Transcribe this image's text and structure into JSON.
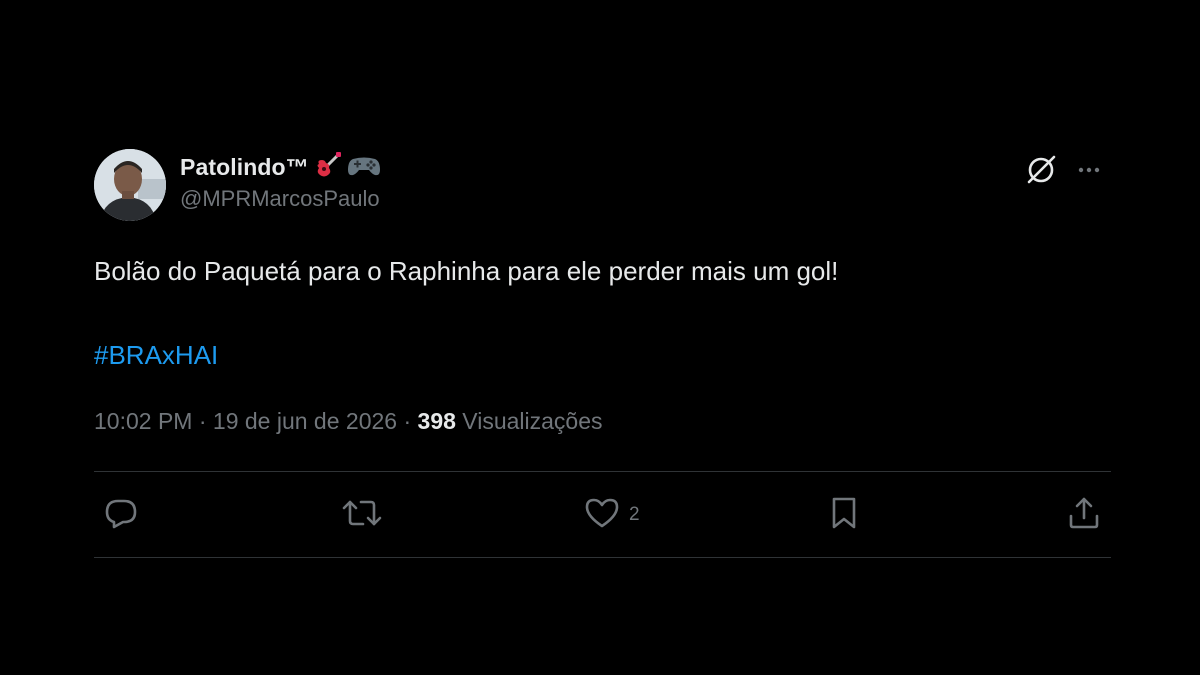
{
  "tweet": {
    "display_name": "Patolindo™",
    "name_emojis": [
      "guitar-emoji",
      "gamepad-emoji"
    ],
    "handle": "@MPRMarcosPaulo",
    "text": "Bolão do Paquetá para o Raphinha para ele perder mais um gol!",
    "hashtag": "#BRAxHAI",
    "time": "10:02 PM",
    "separator": "·",
    "date": "19 de jun de 2026",
    "views_count": "398",
    "views_label": "Visualizações"
  },
  "actions": {
    "reply": {
      "icon": "reply-icon",
      "count": ""
    },
    "repost": {
      "icon": "repost-icon",
      "count": ""
    },
    "like": {
      "icon": "heart-icon",
      "count": "2"
    },
    "bookmark": {
      "icon": "bookmark-icon",
      "count": ""
    },
    "share": {
      "icon": "share-icon",
      "count": ""
    }
  },
  "colors": {
    "background": "#000000",
    "text_primary": "#e7e9ea",
    "text_secondary": "#71767b",
    "link": "#1d9bf0",
    "divider": "#2f3336"
  }
}
